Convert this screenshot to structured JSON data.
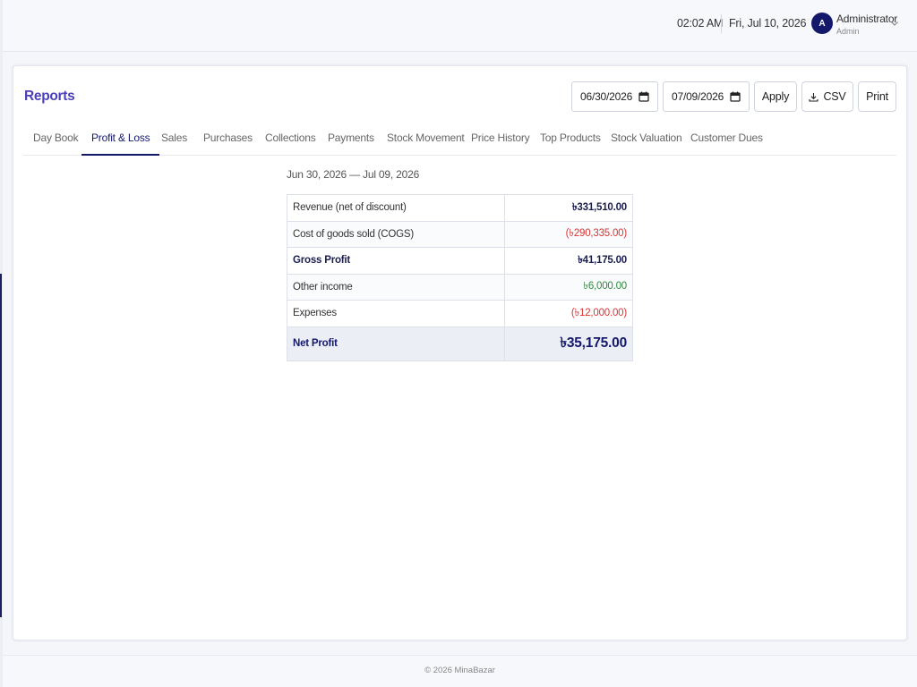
{
  "header": {
    "time": "02:02 AM",
    "date": "Fri, Jul 10, 2026",
    "user": {
      "initial": "A",
      "name": "Administrator",
      "role": "Admin"
    }
  },
  "page": {
    "title": "Reports",
    "date_from": "06/30/2026",
    "date_to": "07/09/2026",
    "apply_label": "Apply",
    "csv_label": "CSV",
    "print_label": "Print"
  },
  "tabs": [
    {
      "label": "Day Book",
      "active": false
    },
    {
      "label": "Profit & Loss",
      "active": true
    },
    {
      "label": "Sales",
      "active": false
    },
    {
      "label": "Purchases",
      "active": false
    },
    {
      "label": "Collections",
      "active": false
    },
    {
      "label": "Payments",
      "active": false
    },
    {
      "label": "Stock Movement",
      "active": false
    },
    {
      "label": "Price History",
      "active": false
    },
    {
      "label": "Top Products",
      "active": false
    },
    {
      "label": "Stock Valuation",
      "active": false
    },
    {
      "label": "Customer Dues",
      "active": false
    }
  ],
  "report": {
    "range": "Jun 30, 2026 — Jul 09, 2026",
    "rows": [
      {
        "label": "Revenue (net of discount)",
        "value": "৳331,510.00",
        "style": "bold"
      },
      {
        "label": "Cost of goods sold (COGS)",
        "value": "(৳290,335.00)",
        "style": "negative"
      },
      {
        "label": "Gross Profit",
        "value": "৳41,175.00",
        "style": "bold"
      },
      {
        "label": "Other income",
        "value": "৳6,000.00",
        "style": "positive"
      },
      {
        "label": "Expenses",
        "value": "(৳12,000.00)",
        "style": "negative"
      }
    ],
    "net": {
      "label": "Net Profit",
      "value": "৳35,175.00"
    }
  },
  "footer": {
    "text": "© 2026 MinaBazar"
  },
  "colors": {
    "brand": "#14186b",
    "title": "#4a3fb8",
    "negative": "#d93636",
    "positive": "#2e8b3e"
  }
}
